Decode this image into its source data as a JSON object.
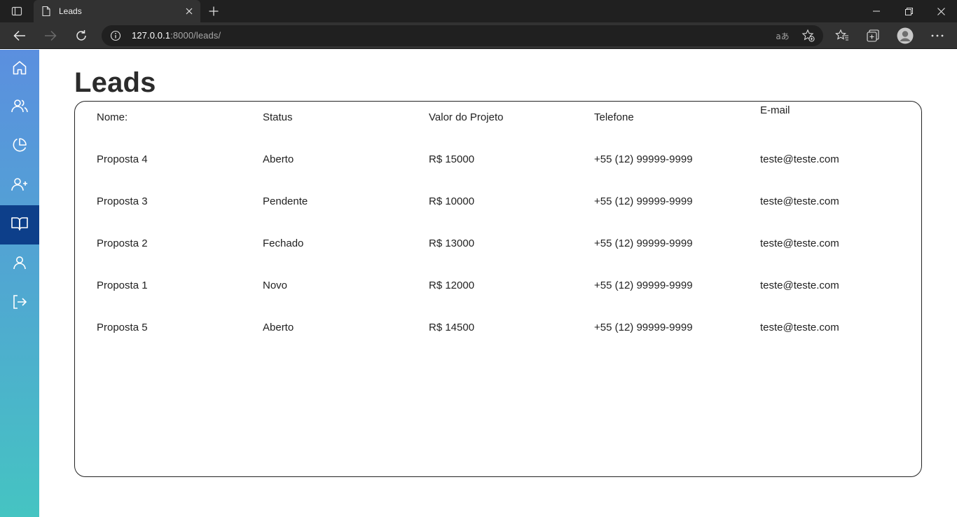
{
  "browser": {
    "tab_title": "Leads",
    "url_host": "127.0.0.1",
    "url_rest": ":8000/leads/",
    "translate_glyph": "aあ"
  },
  "sidebar": {
    "items": [
      {
        "icon": "home-icon",
        "active": false
      },
      {
        "icon": "users-icon",
        "active": false
      },
      {
        "icon": "pie-chart-icon",
        "active": false
      },
      {
        "icon": "user-plus-icon",
        "active": false
      },
      {
        "icon": "book-open-icon",
        "active": true
      },
      {
        "icon": "user-icon",
        "active": false
      },
      {
        "icon": "logout-icon",
        "active": false
      }
    ],
    "active_color": "#0d3f8a"
  },
  "page": {
    "title": "Leads"
  },
  "leads_table": {
    "columns": [
      "Nome:",
      "Status",
      "Valor do Projeto",
      "Telefone",
      "E-mail"
    ],
    "rows": [
      [
        "Proposta 4",
        "Aberto",
        "R$ 15000",
        "+55 (12) 99999-9999",
        "teste@teste.com"
      ],
      [
        "Proposta 3",
        "Pendente",
        "R$ 10000",
        "+55 (12) 99999-9999",
        "teste@teste.com"
      ],
      [
        "Proposta 2",
        "Fechado",
        "R$ 13000",
        "+55 (12) 99999-9999",
        "teste@teste.com"
      ],
      [
        "Proposta 1",
        "Novo",
        "R$ 12000",
        "+55 (12) 99999-9999",
        "teste@teste.com"
      ],
      [
        "Proposta 5",
        "Aberto",
        "R$ 14500",
        "+55 (12) 99999-9999",
        "teste@teste.com"
      ]
    ]
  }
}
